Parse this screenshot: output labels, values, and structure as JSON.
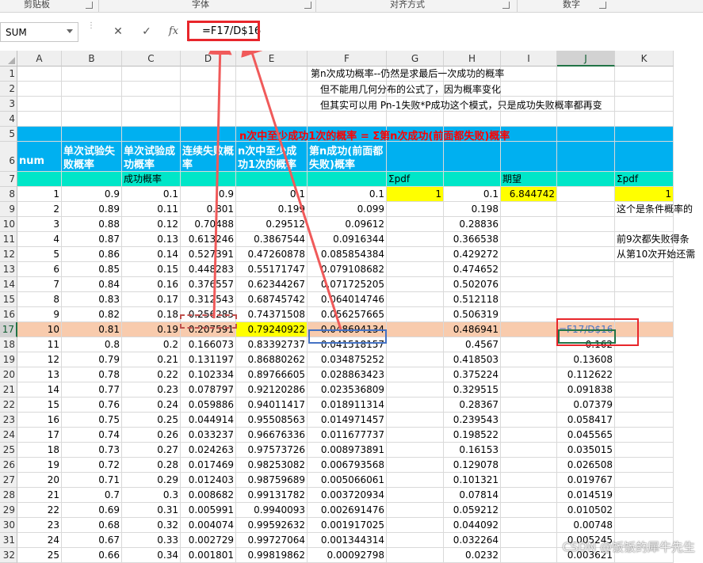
{
  "ribbon": {
    "groups": [
      "剪贴板",
      "字体",
      "对齐方式",
      "数字"
    ]
  },
  "formula_bar": {
    "name_box": "SUM",
    "cancel_icon": "✕",
    "enter_icon": "✓",
    "fx_label": "fx",
    "formula": "=F17/D$16"
  },
  "columns": [
    "A",
    "B",
    "C",
    "D",
    "E",
    "F",
    "G",
    "H",
    "I",
    "J",
    "K"
  ],
  "selected_column": "J",
  "selected_row": "17",
  "rows": [
    "1",
    "2",
    "3",
    "4",
    "5",
    "6",
    "7",
    "8",
    "9",
    "10",
    "11",
    "12",
    "13",
    "14",
    "15",
    "16",
    "17",
    "18",
    "19",
    "20",
    "21",
    "22",
    "23",
    "24",
    "25",
    "26",
    "27",
    "28",
    "29",
    "30",
    "31",
    "32"
  ],
  "notes": {
    "line1": "第n次成功概率--仍然是求最后一次成功的概率",
    "line2": "但不能用几何分布的公式了，因为概率变化",
    "line3": "但其实可以用 Pn-1失败*P成功这个模式，只是成功失败概率都再变",
    "title5": "n次中至少成功1次的概率 = Σ第n次成功(前面都失败)概率"
  },
  "headers": {
    "num": "num",
    "fail_prob": "单次试验失败概率",
    "success_prob": "单次试验成功概率",
    "consec_fail": "连续失败概率",
    "at_least_one": "n次中至少成功1次的概率",
    "nth_success": "第n成功(前面都失败)概率",
    "success_prob_label": "成功概率",
    "sigma_pdf": "Σpdf",
    "expectation": "期望",
    "sigma_pdf2": "Σpdf"
  },
  "summary": {
    "g8": "1",
    "h8": "0.1",
    "i8": "6.844742",
    "k8": "1",
    "k9": "这个是条件概率的",
    "k11": "前9次都失败得条",
    "k12": "从第10次开始还需"
  },
  "j17_formula": "=F17/D$16",
  "table": [
    {
      "r": "8",
      "a": "1",
      "b": "0.9",
      "c": "0.1",
      "d": "0.9",
      "e": "0.1",
      "f": "0.1",
      "h": "",
      "j": ""
    },
    {
      "r": "9",
      "a": "2",
      "b": "0.89",
      "c": "0.11",
      "d": "0.801",
      "e": "0.199",
      "f": "0.099",
      "h": "0.198",
      "j": ""
    },
    {
      "r": "10",
      "a": "3",
      "b": "0.88",
      "c": "0.12",
      "d": "0.70488",
      "e": "0.29512",
      "f": "0.09612",
      "h": "0.28836",
      "j": ""
    },
    {
      "r": "11",
      "a": "4",
      "b": "0.87",
      "c": "0.13",
      "d": "0.613246",
      "e": "0.3867544",
      "f": "0.0916344",
      "h": "0.366538",
      "j": ""
    },
    {
      "r": "12",
      "a": "5",
      "b": "0.86",
      "c": "0.14",
      "d": "0.527391",
      "e": "0.47260878",
      "f": "0.085854384",
      "h": "0.429272",
      "j": ""
    },
    {
      "r": "13",
      "a": "6",
      "b": "0.85",
      "c": "0.15",
      "d": "0.448283",
      "e": "0.55171747",
      "f": "0.079108682",
      "h": "0.474652",
      "j": ""
    },
    {
      "r": "14",
      "a": "7",
      "b": "0.84",
      "c": "0.16",
      "d": "0.376557",
      "e": "0.62344267",
      "f": "0.071725205",
      "h": "0.502076",
      "j": ""
    },
    {
      "r": "15",
      "a": "8",
      "b": "0.83",
      "c": "0.17",
      "d": "0.312543",
      "e": "0.68745742",
      "f": "0.064014746",
      "h": "0.512118",
      "j": ""
    },
    {
      "r": "16",
      "a": "9",
      "b": "0.82",
      "c": "0.18",
      "d": "0.256285",
      "e": "0.74371508",
      "f": "0.056257665",
      "h": "0.506319",
      "j": ""
    },
    {
      "r": "17",
      "a": "10",
      "b": "0.81",
      "c": "0.19",
      "d": "0.207591",
      "e": "0.79240922",
      "f": "0.048694134",
      "h": "0.486941",
      "j": ""
    },
    {
      "r": "18",
      "a": "11",
      "b": "0.8",
      "c": "0.2",
      "d": "0.166073",
      "e": "0.83392737",
      "f": "0.041518157",
      "h": "0.4567",
      "j": "0.162"
    },
    {
      "r": "19",
      "a": "12",
      "b": "0.79",
      "c": "0.21",
      "d": "0.131197",
      "e": "0.86880262",
      "f": "0.034875252",
      "h": "0.418503",
      "j": "0.13608"
    },
    {
      "r": "20",
      "a": "13",
      "b": "0.78",
      "c": "0.22",
      "d": "0.102334",
      "e": "0.89766605",
      "f": "0.028863423",
      "h": "0.375224",
      "j": "0.112622"
    },
    {
      "r": "21",
      "a": "14",
      "b": "0.77",
      "c": "0.23",
      "d": "0.078797",
      "e": "0.92120286",
      "f": "0.023536809",
      "h": "0.329515",
      "j": "0.091838"
    },
    {
      "r": "22",
      "a": "15",
      "b": "0.76",
      "c": "0.24",
      "d": "0.059886",
      "e": "0.94011417",
      "f": "0.018911314",
      "h": "0.28367",
      "j": "0.07379"
    },
    {
      "r": "23",
      "a": "16",
      "b": "0.75",
      "c": "0.25",
      "d": "0.044914",
      "e": "0.95508563",
      "f": "0.014971457",
      "h": "0.239543",
      "j": "0.058417"
    },
    {
      "r": "24",
      "a": "17",
      "b": "0.74",
      "c": "0.26",
      "d": "0.033237",
      "e": "0.96676336",
      "f": "0.011677737",
      "h": "0.198522",
      "j": "0.045565"
    },
    {
      "r": "25",
      "a": "18",
      "b": "0.73",
      "c": "0.27",
      "d": "0.024263",
      "e": "0.97573726",
      "f": "0.008973891",
      "h": "0.16153",
      "j": "0.035015"
    },
    {
      "r": "26",
      "a": "19",
      "b": "0.72",
      "c": "0.28",
      "d": "0.017469",
      "e": "0.98253082",
      "f": "0.006793568",
      "h": "0.129078",
      "j": "0.026508"
    },
    {
      "r": "27",
      "a": "20",
      "b": "0.71",
      "c": "0.29",
      "d": "0.012403",
      "e": "0.98759689",
      "f": "0.005066061",
      "h": "0.101321",
      "j": "0.019767"
    },
    {
      "r": "28",
      "a": "21",
      "b": "0.7",
      "c": "0.3",
      "d": "0.008682",
      "e": "0.99131782",
      "f": "0.003720934",
      "h": "0.07814",
      "j": "0.014519"
    },
    {
      "r": "29",
      "a": "22",
      "b": "0.69",
      "c": "0.31",
      "d": "0.005991",
      "e": "0.9940093",
      "f": "0.002691476",
      "h": "0.059212",
      "j": "0.010502"
    },
    {
      "r": "30",
      "a": "23",
      "b": "0.68",
      "c": "0.32",
      "d": "0.004074",
      "e": "0.99592632",
      "f": "0.001917025",
      "h": "0.044092",
      "j": "0.00748"
    },
    {
      "r": "31",
      "a": "24",
      "b": "0.67",
      "c": "0.33",
      "d": "0.002729",
      "e": "0.99727064",
      "f": "0.001344314",
      "h": "0.032264",
      "j": "0.005245"
    },
    {
      "r": "32",
      "a": "25",
      "b": "0.66",
      "c": "0.34",
      "d": "0.001801",
      "e": "0.99819862",
      "f": "0.00092798",
      "h": "0.0232",
      "j": "0.003621"
    }
  ],
  "watermark": "CSDN @饭饭的犀牛先生",
  "colors": {
    "band_blue": "#00b0f0",
    "band_teal": "#00e6c8",
    "highlight_row": "#f8cbad",
    "yellow": "#ffff00",
    "callout_red": "#e8262b",
    "excel_green": "#217346"
  }
}
